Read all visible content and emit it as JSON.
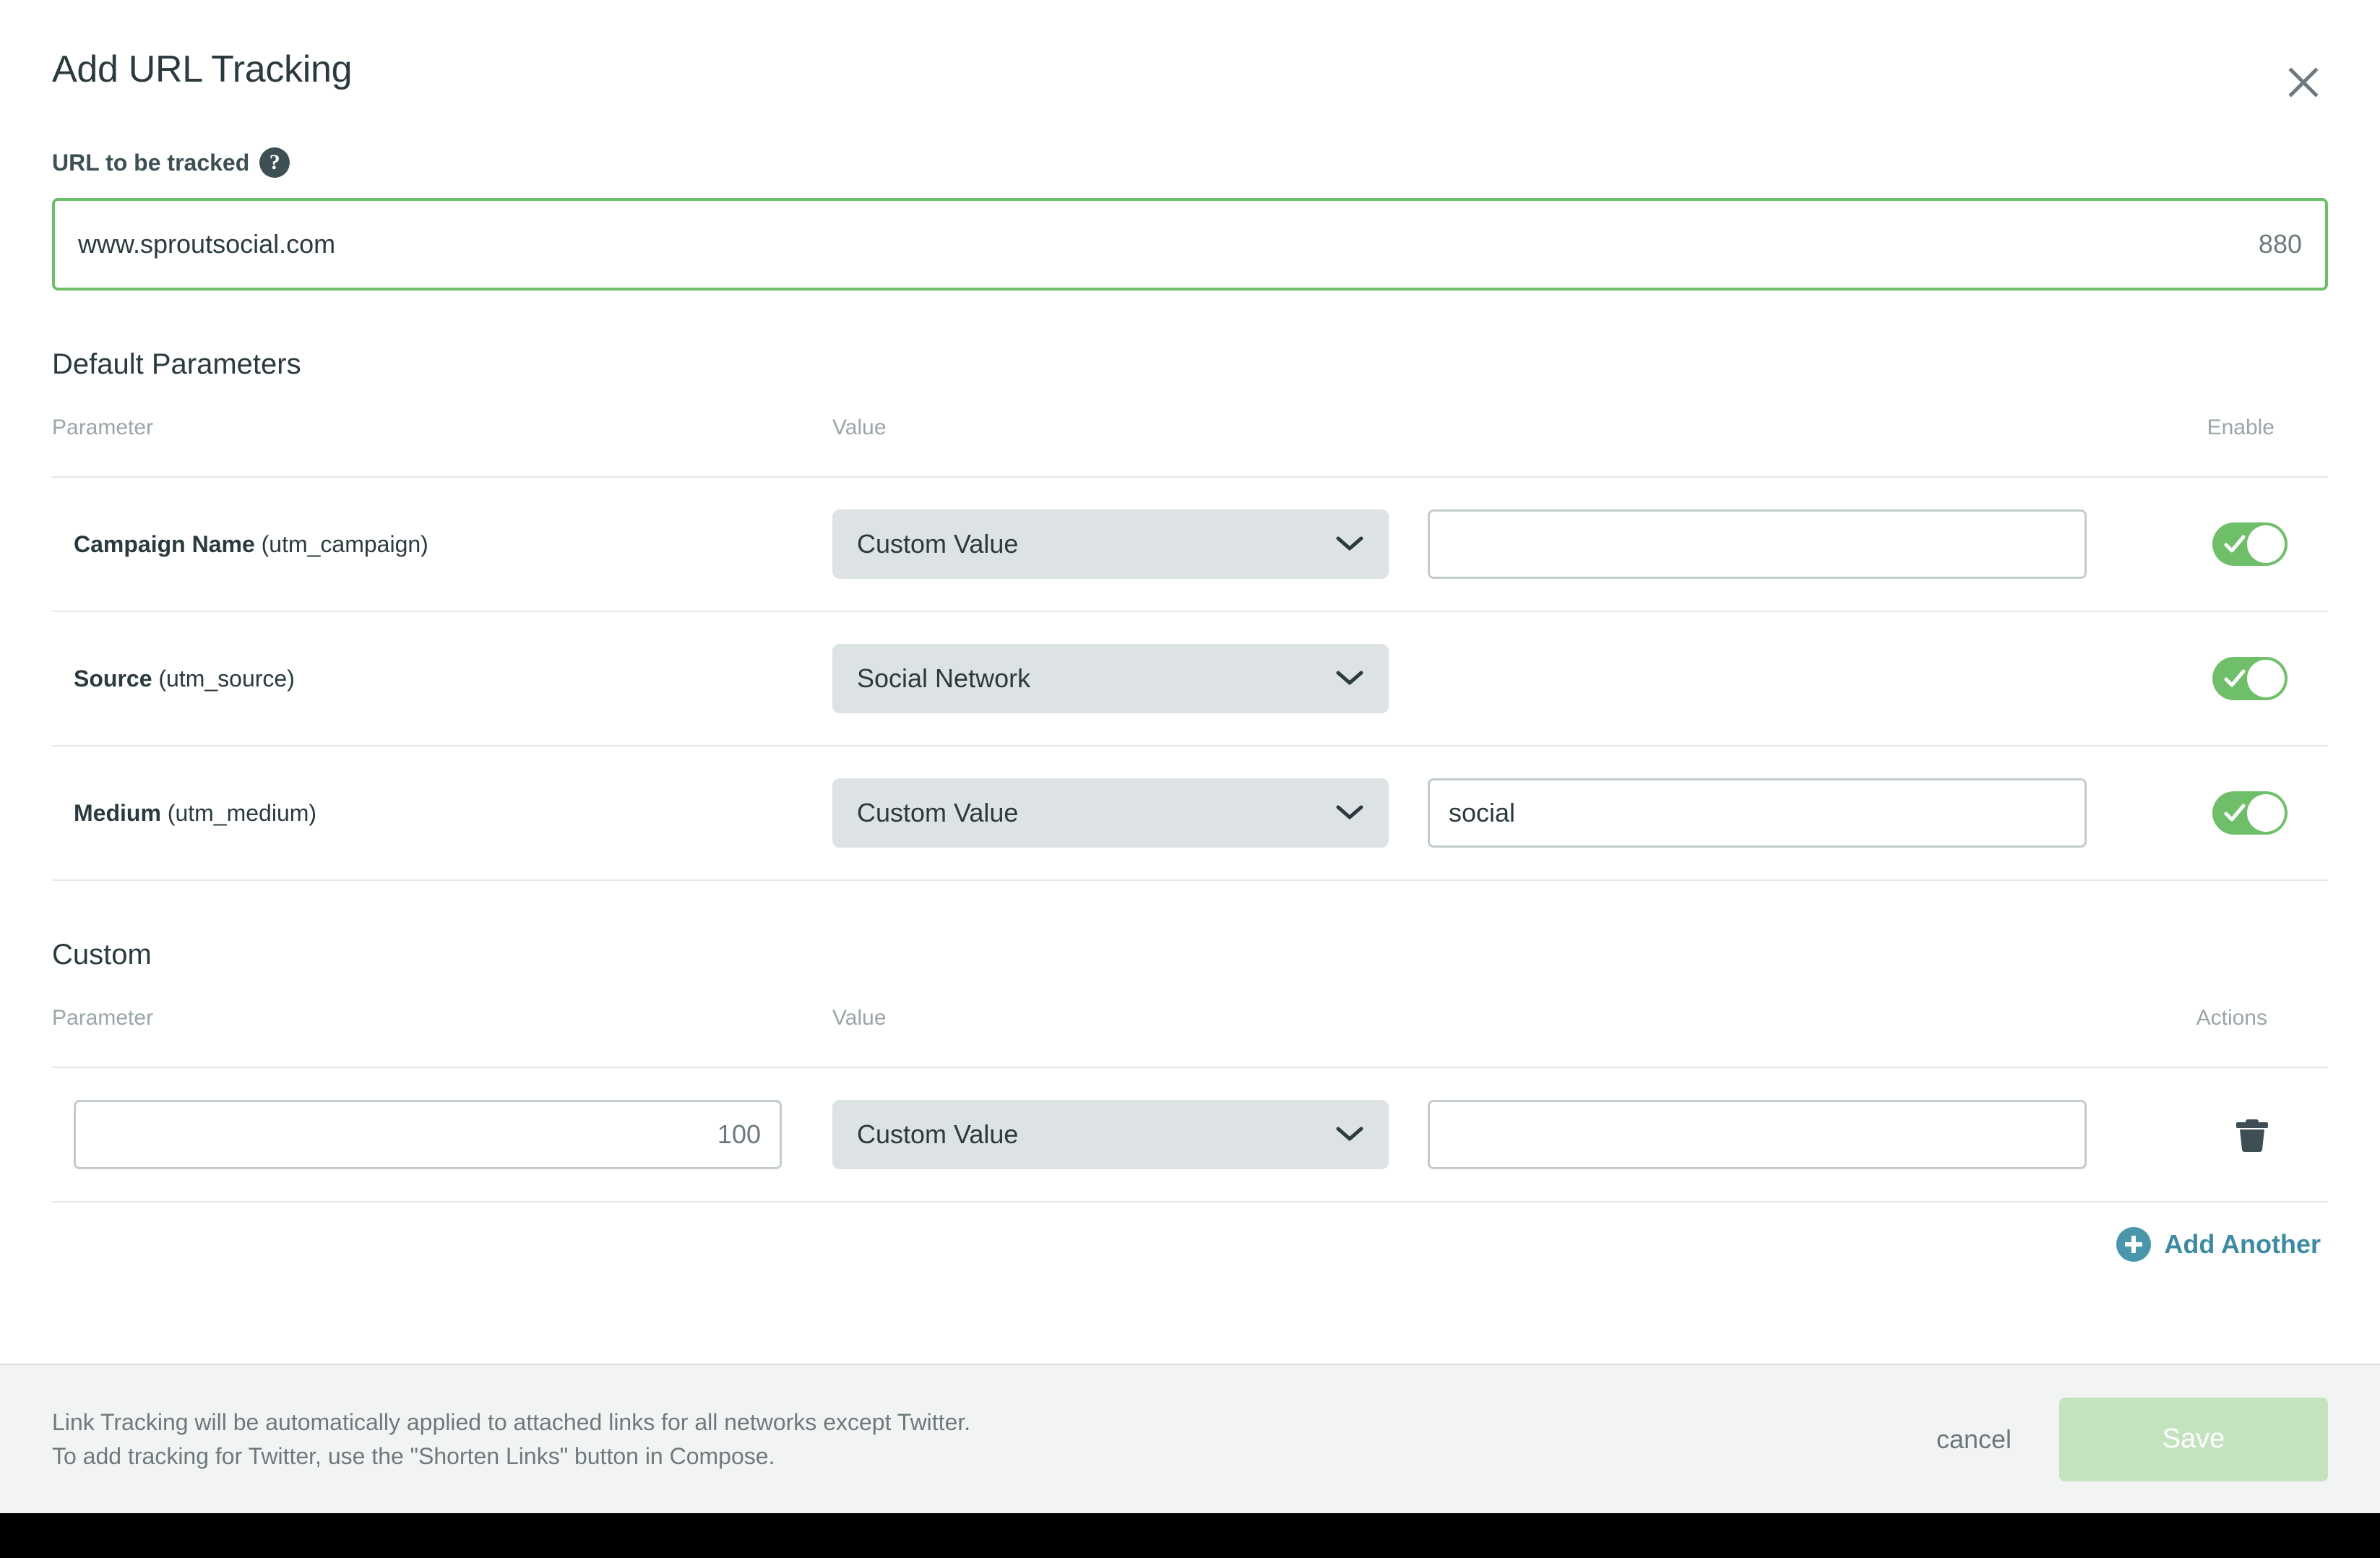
{
  "header": {
    "title": "Add URL Tracking",
    "close_icon": "close-icon"
  },
  "url_section": {
    "label": "URL to be tracked",
    "help_icon": "help-icon",
    "value": "www.sproutsocial.com",
    "placeholder": "",
    "counter": "880",
    "border_color": "#6fbf6a"
  },
  "default_parameters": {
    "title": "Default Parameters",
    "columns": {
      "parameter": "Parameter",
      "value": "Value",
      "enable": "Enable"
    },
    "rows": [
      {
        "name": "Campaign Name",
        "code": " (utm_campaign)",
        "select_value": "Custom Value",
        "text_value": "",
        "text_placeholder": "",
        "has_text_input": true,
        "enabled": true
      },
      {
        "name": "Source",
        "code": " (utm_source)",
        "select_value": "Social Network",
        "text_value": "",
        "text_placeholder": "",
        "has_text_input": false,
        "enabled": true
      },
      {
        "name": "Medium",
        "code": " (utm_medium)",
        "select_value": "Custom Value",
        "text_value": "social",
        "text_placeholder": "",
        "has_text_input": true,
        "enabled": true
      }
    ]
  },
  "custom_section": {
    "title": "Custom",
    "columns": {
      "parameter": "Parameter",
      "value": "Value",
      "actions": "Actions"
    },
    "rows": [
      {
        "param_value": "",
        "param_placeholder": "",
        "param_counter": "100",
        "select_value": "Custom Value",
        "text_value": "",
        "text_placeholder": "",
        "delete_icon": "trash-icon"
      }
    ],
    "add_another_label": "Add Another",
    "add_another_icon": "plus-circle-icon",
    "add_another_color": "#3c8ba2"
  },
  "footer": {
    "note_line1": "Link Tracking will be automatically applied to attached links for all networks except Twitter.",
    "note_line2": "To add tracking for Twitter, use the \"Shorten Links\" button in Compose.",
    "cancel_label": "cancel",
    "save_label": "Save",
    "save_color": "#c3e3bf"
  }
}
